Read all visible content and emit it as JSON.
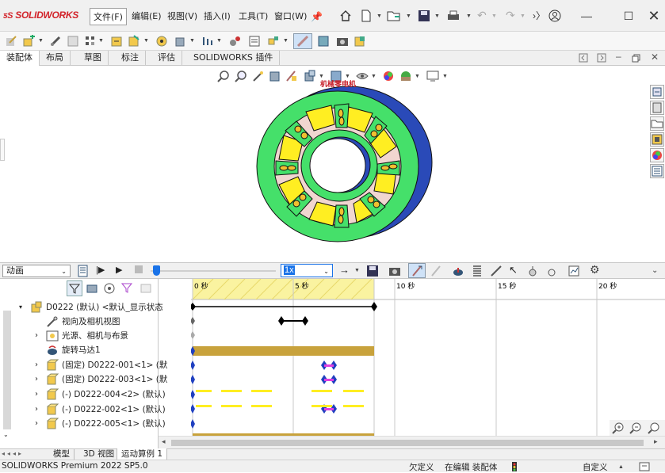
{
  "app": {
    "logo_text": "SOLIDWORKS"
  },
  "menu": [
    {
      "label": "文件(F)",
      "active": true
    },
    {
      "label": "编辑(E)"
    },
    {
      "label": "视图(V)"
    },
    {
      "label": "插入(I)"
    },
    {
      "label": "工具(T)"
    },
    {
      "label": "窗口(W)"
    }
  ],
  "command_tabs": [
    "装配体",
    "布局",
    "草图",
    "标注",
    "评估",
    "SOLIDWORKS 插件"
  ],
  "model": {
    "label_text": "机械零电机"
  },
  "animation": {
    "study_type": "动画",
    "playback_speed": "1x",
    "time_labels": [
      "0 秒",
      "5 秒",
      "10 秒",
      "15 秒",
      "20 秒"
    ]
  },
  "tree": {
    "items": [
      {
        "label": "D0222 (默认) <默认_显示状态",
        "expander": "▾"
      },
      {
        "label": "视向及相机视图",
        "expander": ""
      },
      {
        "label": "光源、相机与布景",
        "expander": "›"
      },
      {
        "label": "旋转马达1",
        "expander": ""
      },
      {
        "label": "(固定) D0222-001<1> (默",
        "expander": "›"
      },
      {
        "label": "(固定) D0222-003<1> (默",
        "expander": "›"
      },
      {
        "label": "(-) D0222-004<2> (默认)",
        "expander": "›"
      },
      {
        "label": "(-) D0222-002<1> (默认)",
        "expander": "›"
      },
      {
        "label": "(-) D0222-005<1> (默认)",
        "expander": "›"
      }
    ]
  },
  "bottom_tabs": [
    "模型",
    "3D 视图",
    "运动算例 1"
  ],
  "status": {
    "version": "SOLIDWORKS Premium 2022 SP5.0",
    "definition": "欠定义",
    "editing": "在编辑 装配体",
    "units": "自定义"
  },
  "colors": {
    "wheel_green": "#45e06a",
    "magnet_yellow": "#ffee22",
    "hub_blue": "#2a4ab8",
    "timebar_gold": "#c8a23c",
    "key_blue": "#2040c0"
  }
}
